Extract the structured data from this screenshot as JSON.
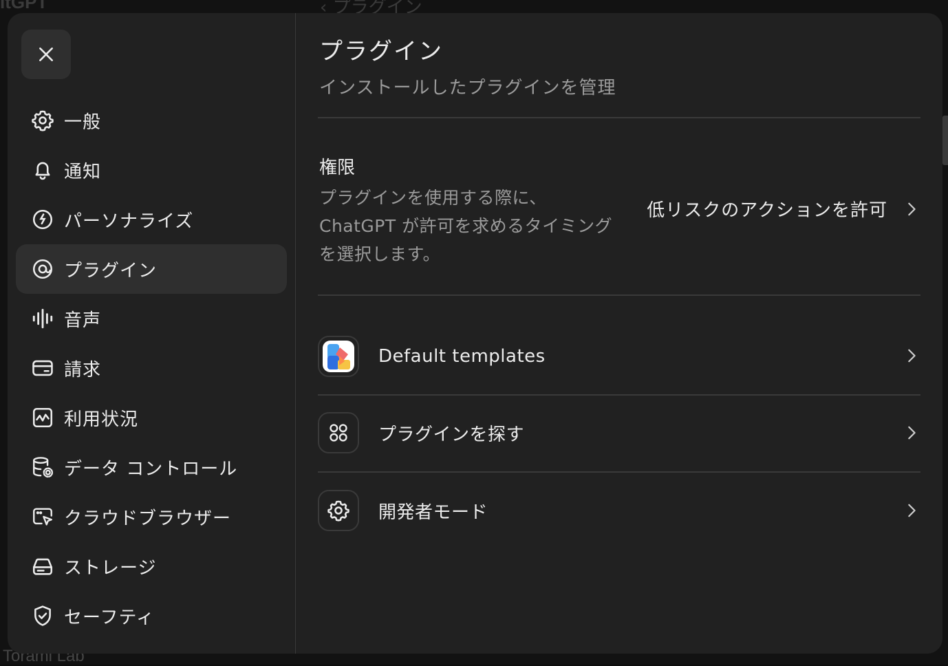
{
  "background": {
    "top_title": "itGPT",
    "top_nav": "‹ プラグイン",
    "footer": "Torami Lab"
  },
  "close_button": {
    "icon": "close-icon"
  },
  "sidebar": {
    "items": [
      {
        "label": "一般",
        "icon": "gear-icon",
        "active": false
      },
      {
        "label": "通知",
        "icon": "bell-icon",
        "active": false
      },
      {
        "label": "パーソナライズ",
        "icon": "personalize-icon",
        "active": false
      },
      {
        "label": "プラグイン",
        "icon": "plugin-icon",
        "active": true
      },
      {
        "label": "音声",
        "icon": "waveform-icon",
        "active": false
      },
      {
        "label": "請求",
        "icon": "card-icon",
        "active": false
      },
      {
        "label": "利用状況",
        "icon": "activity-icon",
        "active": false
      },
      {
        "label": "データ コントロール",
        "icon": "database-gear-icon",
        "active": false
      },
      {
        "label": "クラウドブラウザー",
        "icon": "browser-cursor-icon",
        "active": false
      },
      {
        "label": "ストレージ",
        "icon": "drive-icon",
        "active": false
      },
      {
        "label": "セーフティ",
        "icon": "shield-check-icon",
        "active": false
      }
    ]
  },
  "main": {
    "title": "プラグイン",
    "subtitle": "インストールしたプラグインを管理",
    "permissions": {
      "title": "権限",
      "description": "プラグインを使用する際に、ChatGPT が許可を求めるタイミングを選択します。",
      "value": "低リスクのアクションを許可"
    },
    "rows": [
      {
        "label": "Default templates",
        "icon": "default-templates-app-icon"
      },
      {
        "label": "プラグインを探す",
        "icon": "grid-circles-icon"
      },
      {
        "label": "開発者モード",
        "icon": "gear-icon"
      }
    ]
  },
  "colors": {
    "modal_bg": "#212121",
    "active_item_bg": "#2f2f2f",
    "text_primary": "#ececec",
    "text_secondary": "#9b9b9b",
    "divider": "#3a3a3a"
  }
}
